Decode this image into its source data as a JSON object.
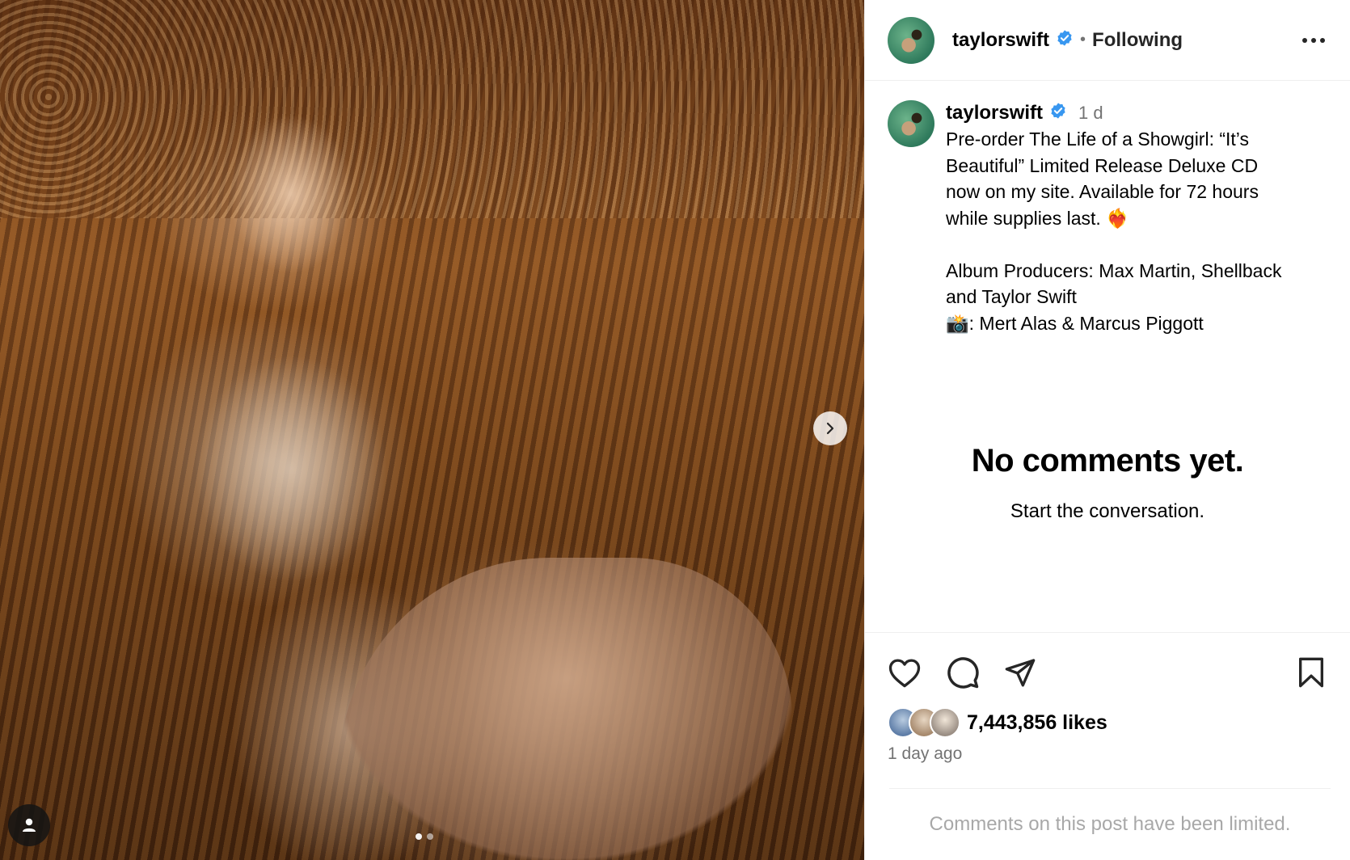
{
  "post": {
    "username": "taylorswift",
    "separator": "•",
    "follow_status": "Following",
    "time_ago": "1 d",
    "caption_lines": [
      "Pre-order The Life of a Showgirl: “It’s",
      "Beautiful” Limited Release Deluxe CD",
      "now on my site. Available for 72 hours",
      "while supplies last. ❤️‍🔥",
      "",
      "Album Producers: Max Martin, Shellback",
      "and Taylor Swift",
      "📸: Mert Alas & Marcus Piggott"
    ],
    "likes": "7,443,856 likes",
    "posted_ago": "1 day ago"
  },
  "comments": {
    "empty_title": "No comments yet.",
    "empty_subtitle": "Start the conversation.",
    "limited_notice": "Comments on this post have been limited."
  },
  "media": {
    "image_description_icon": "photo",
    "carousel_dots": 2,
    "active_dot": 0
  },
  "icons": {
    "verified": "verified-badge-icon",
    "more": "more-options-icon",
    "like": "heart-icon",
    "comment": "comment-icon",
    "share": "share-icon",
    "save": "bookmark-icon",
    "next": "chevron-right-icon",
    "tags": "user-tag-icon"
  },
  "colors": {
    "verified_blue": "#3897f0",
    "text_secondary": "#737373",
    "text_muted": "#a8a8a8",
    "divider": "#efefef"
  }
}
